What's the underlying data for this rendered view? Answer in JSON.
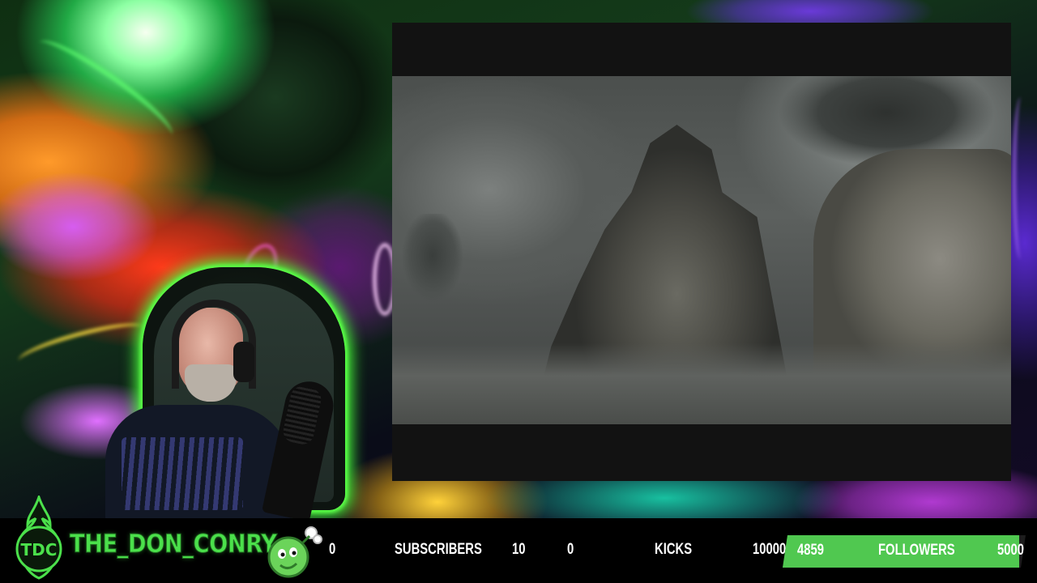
{
  "overlay": {
    "channel_name": "THE_DON_CONRY",
    "logo_text": "TDC",
    "subscribers": {
      "current": "0",
      "label": "SUBSCRIBERS",
      "goal": "10"
    },
    "kicks": {
      "current": "0",
      "label": "KICKS",
      "goal": "10000"
    },
    "followers": {
      "current": "4859",
      "label": "FOLLOWERS",
      "goal": "5000",
      "progress_fraction": 0.9718
    }
  },
  "colors": {
    "brand_green": "#4be04b",
    "followers_fill": "#50c850",
    "webcam_glow": "#48ff3a",
    "bar_background": "#000000"
  },
  "icons": [
    "tdc-logo-icon",
    "mascot-icon"
  ]
}
